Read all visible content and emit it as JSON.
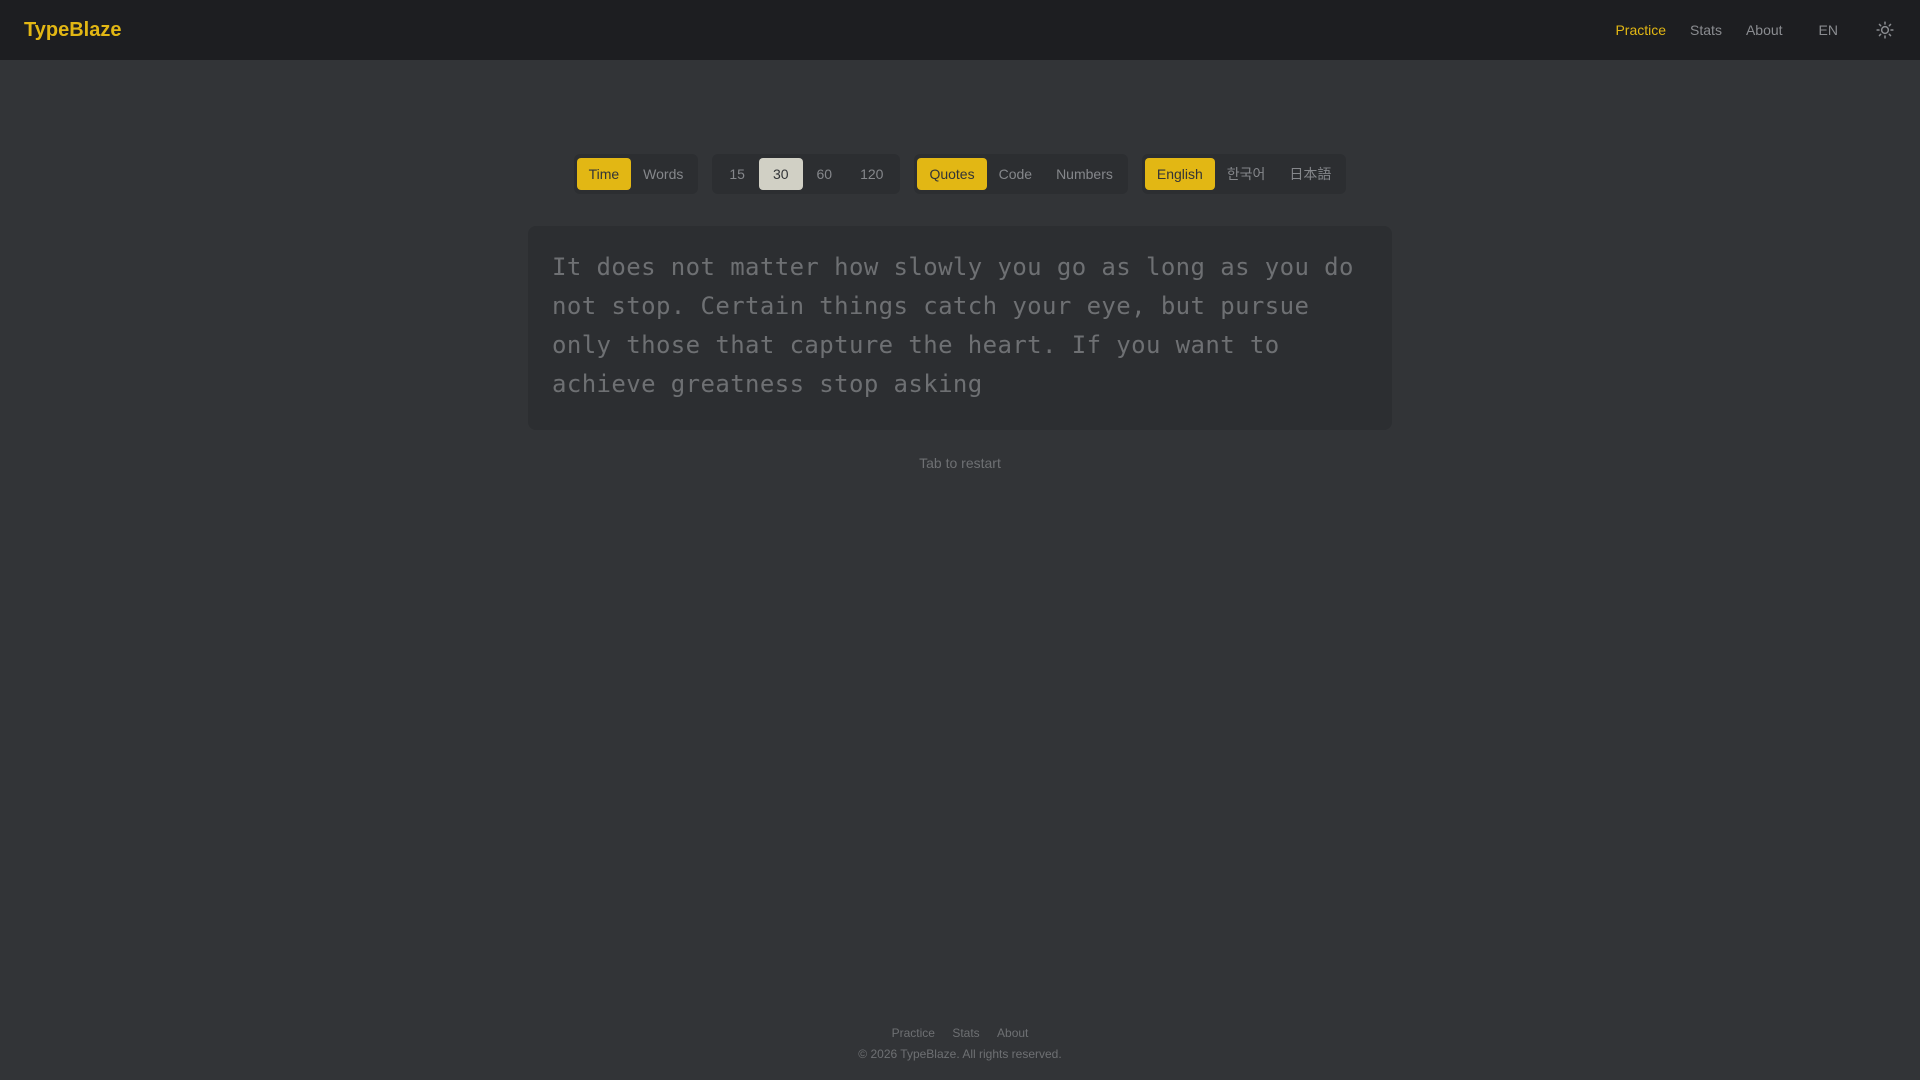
{
  "app": {
    "logo": "TypeBlaze"
  },
  "nav": {
    "items": [
      {
        "label": "Practice",
        "active": true
      },
      {
        "label": "Stats",
        "active": false
      },
      {
        "label": "About",
        "active": false
      }
    ],
    "language": "EN",
    "theme_icon": "sun-icon"
  },
  "config": {
    "mode": {
      "options": [
        "Time",
        "Words"
      ],
      "selected": "Time"
    },
    "duration": {
      "options": [
        "15",
        "30",
        "60",
        "120"
      ],
      "selected": "30"
    },
    "content": {
      "options": [
        "Quotes",
        "Code",
        "Numbers"
      ],
      "selected": "Quotes"
    },
    "language": {
      "options": [
        "English",
        "한국어",
        "日本語"
      ],
      "selected": "English"
    }
  },
  "test": {
    "text": "It does not matter how slowly you go as long as you do not stop. Certain things catch your eye, but pursue only those that capture the heart. If you want to achieve greatness stop asking",
    "hint": "Tab to restart"
  },
  "footer": {
    "links": [
      "Practice",
      "Stats",
      "About"
    ],
    "copyright": "© 2026 TypeBlaze. All rights reserved."
  },
  "colors": {
    "accent": "#e2b714",
    "background": "#323437",
    "header": "#1d1e21",
    "panel": "#2c2e31",
    "text_muted": "#6e7073"
  }
}
